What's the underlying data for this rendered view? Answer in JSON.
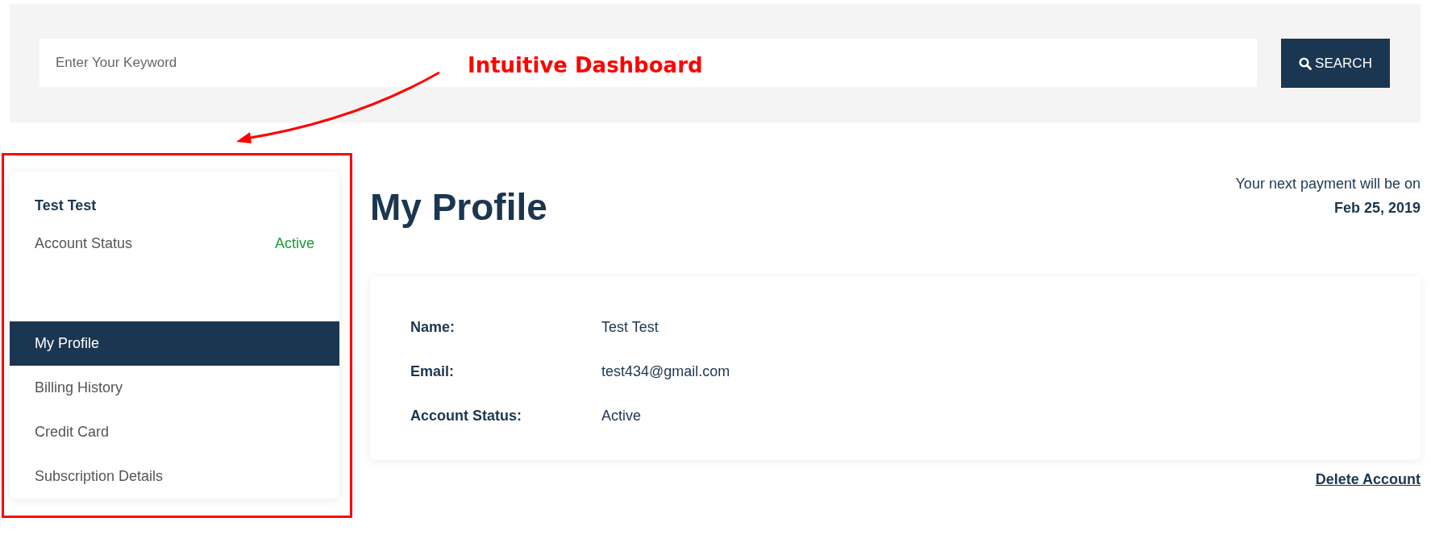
{
  "search": {
    "placeholder": "Enter Your Keyword",
    "button": "SEARCH"
  },
  "annotation": {
    "label": "Intuitive Dashboard"
  },
  "sidebar": {
    "user_name": "Test Test",
    "status_label": "Account Status",
    "status_value": "Active",
    "items": [
      {
        "label": "My Profile",
        "selected": true
      },
      {
        "label": "Billing History",
        "selected": false
      },
      {
        "label": "Credit Card",
        "selected": false
      },
      {
        "label": "Subscription Details",
        "selected": false
      }
    ]
  },
  "main": {
    "title": "My Profile",
    "payment_note": "Your next payment will be on",
    "payment_date": "Feb 25, 2019",
    "fields": [
      {
        "label": "Name:",
        "value": "Test Test"
      },
      {
        "label": "Email:",
        "value": "test434@gmail.com"
      },
      {
        "label": "Account Status:",
        "value": "Active"
      }
    ],
    "delete_link": "Delete Account"
  }
}
